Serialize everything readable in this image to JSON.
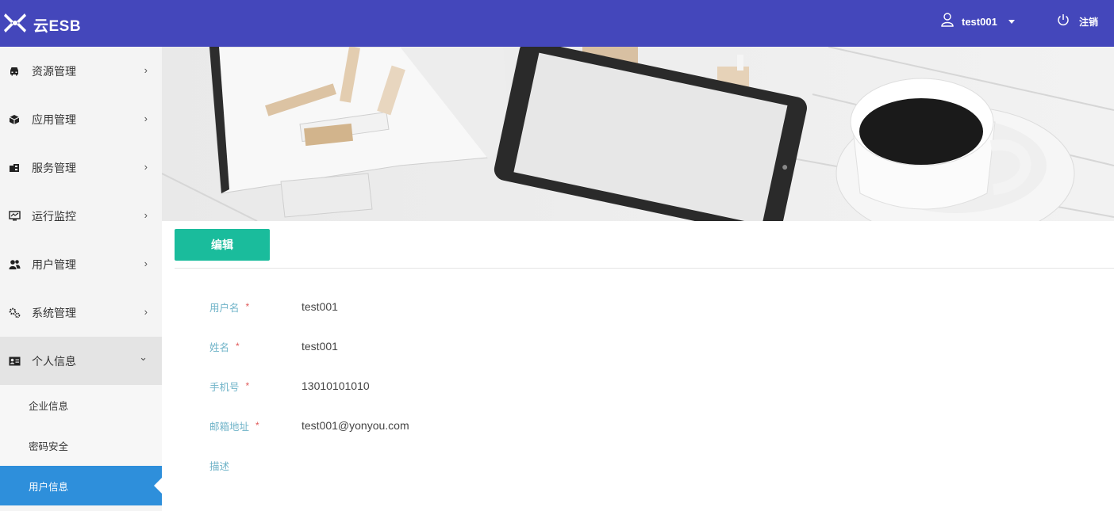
{
  "header": {
    "app_title": "云ESB",
    "username": "test001",
    "logout_label": "注销",
    "bg_color": "#4447bb"
  },
  "sidebar": {
    "items": [
      {
        "label": "资源管理",
        "icon": "car-icon",
        "arrow": "›"
      },
      {
        "label": "应用管理",
        "icon": "cube-icon",
        "arrow": "›"
      },
      {
        "label": "服务管理",
        "icon": "service-icon",
        "arrow": "›"
      },
      {
        "label": "运行监控",
        "icon": "monitor-icon",
        "arrow": "›"
      },
      {
        "label": "用户管理",
        "icon": "users-icon",
        "arrow": "›"
      },
      {
        "label": "系统管理",
        "icon": "gears-icon",
        "arrow": "›"
      },
      {
        "label": "个人信息",
        "icon": "id-card-icon",
        "arrow": "⌄"
      }
    ],
    "sub_items": [
      {
        "label": "企业信息"
      },
      {
        "label": "密码安全"
      },
      {
        "label": "用户信息",
        "active": true
      }
    ],
    "active_color": "#2e8fdb"
  },
  "main": {
    "edit_label": "编辑",
    "edit_color": "#1abc9c",
    "form": [
      {
        "label": "用户名",
        "required": "*",
        "value": "test001"
      },
      {
        "label": "姓名",
        "required": "*",
        "value": "test001"
      },
      {
        "label": "手机号",
        "required": "*",
        "value": "13010101010"
      },
      {
        "label": "邮箱地址",
        "required": "*",
        "value": "test001@yonyou.com"
      },
      {
        "label": "描述",
        "required": "",
        "value": ""
      }
    ]
  }
}
